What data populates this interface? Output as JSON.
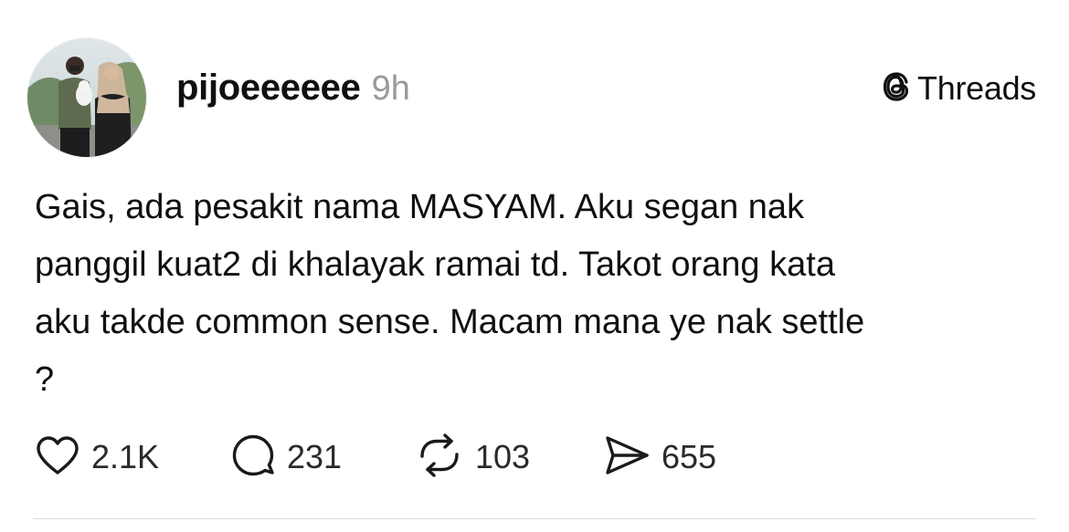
{
  "post": {
    "username": "pijoeeeeee",
    "timestamp": "9h",
    "brand_label": "Threads",
    "text": "Gais, ada pesakit nama MASYAM. Aku segan nak\npanggil kuat2 di khalayak ramai td. Takot orang kata\naku takde common sense. Macam mana ye nak settle\n?",
    "actions": {
      "likes": "2.1K",
      "replies": "231",
      "reposts": "103",
      "shares": "655"
    }
  },
  "icons": {
    "brand": "threads-logo-icon",
    "like": "heart-icon",
    "reply": "comment-bubble-icon",
    "repost": "repost-arrows-icon",
    "share": "send-icon"
  },
  "colors": {
    "text": "#101010",
    "muted": "#9a9a9a",
    "divider": "#dcdcdc"
  }
}
